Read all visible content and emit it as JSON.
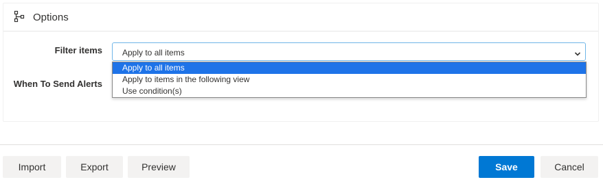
{
  "panel": {
    "title": "Options",
    "icon": "flow-icon"
  },
  "fields": {
    "filter_label": "Filter items",
    "alerts_label": "When To Send Alerts"
  },
  "filter_select": {
    "value": "Apply to all items",
    "options": [
      {
        "label": "Apply to all items",
        "selected": true
      },
      {
        "label": "Apply to items in the following view",
        "selected": false
      },
      {
        "label": "Use condition(s)",
        "selected": false
      }
    ]
  },
  "footer": {
    "import_label": "Import",
    "export_label": "Export",
    "preview_label": "Preview",
    "save_label": "Save",
    "cancel_label": "Cancel"
  },
  "colors": {
    "primary": "#0078d4",
    "selected_option": "#1e73e8",
    "select_border": "#6fb5e8",
    "secondary_button": "#f3f2f1"
  }
}
